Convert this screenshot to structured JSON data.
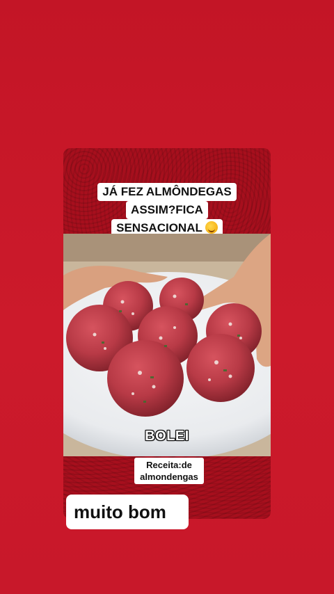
{
  "story": {
    "title_lines": [
      "JÁ FEZ ALMÔNDEGAS",
      "ASSIM?FICA",
      "SENSACIONAL"
    ],
    "title_emoji": "yum-face-emoji",
    "video_overlay_text": "BOLEI",
    "caption_lines": [
      "Receita:de",
      "almondengas"
    ],
    "comment_text": "muito bom"
  },
  "colors": {
    "background": "#c8182a",
    "card_background": "#a70f1d",
    "text_box": "#ffffff"
  }
}
